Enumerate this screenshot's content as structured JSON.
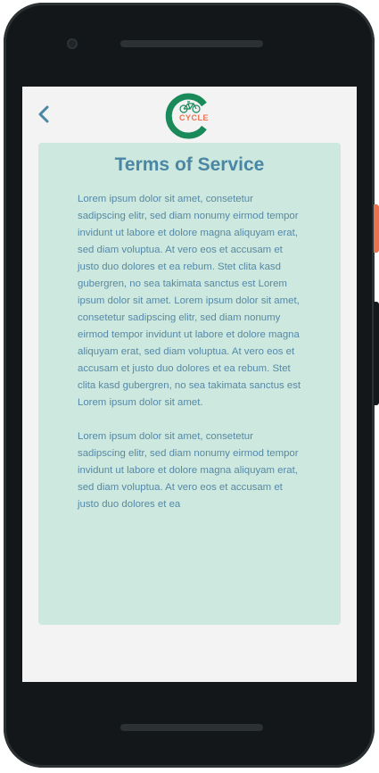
{
  "header": {
    "back_icon": "chevron-left-icon",
    "logo_text": "CYCLE",
    "logo_icon": "bicycle-icon"
  },
  "terms": {
    "title": "Terms of Service",
    "paragraphs": [
      "Lorem ipsum dolor sit amet, consetetur sadipscing elitr, sed diam nonumy eirmod tempor invidunt ut labore et dolore magna aliquyam erat, sed diam voluptua. At vero eos et accusam et justo duo dolores et ea rebum. Stet clita kasd gubergren, no sea takimata sanctus est Lorem ipsum dolor sit amet. Lorem ipsum dolor sit amet, consetetur sadipscing elitr, sed diam nonumy eirmod tempor invidunt ut labore et dolore magna aliquyam erat, sed diam voluptua. At vero eos et accusam et justo duo dolores et ea rebum. Stet clita kasd gubergren, no sea takimata sanctus est Lorem ipsum dolor sit amet.",
      "Lorem ipsum dolor sit amet, consetetur sadipscing elitr, sed diam nonumy eirmod tempor invidunt ut labore et dolore magna aliquyam erat, sed diam voluptua. At vero eos et accusam et justo duo dolores et ea"
    ]
  },
  "colors": {
    "accent": "#4a87a4",
    "card_bg": "#cde8de",
    "logo_green": "#1a8a5a",
    "logo_orange": "#e8734f"
  }
}
